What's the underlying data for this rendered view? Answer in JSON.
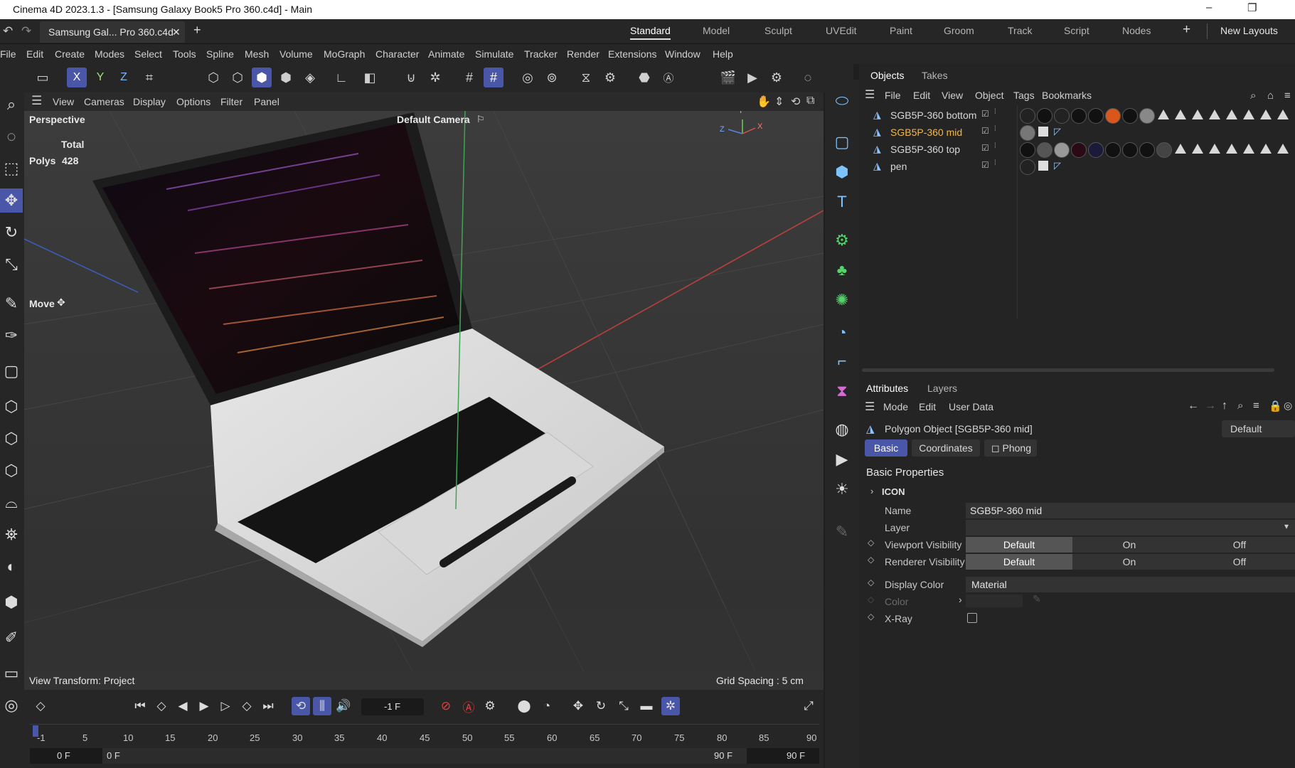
{
  "window": {
    "title": "Cinema 4D 2023.1.3 - [Samsung Galaxy Book5 Pro 360.c4d] - Main",
    "minimize": "–",
    "maximize": "❐",
    "close": "✕"
  },
  "tabs": {
    "doc_tab": "Samsung Gal... Pro 360.c4d",
    "doc_close": "✕",
    "add": "+",
    "layouts": [
      "Standard",
      "Model",
      "Sculpt",
      "UVEdit",
      "Paint",
      "Groom",
      "Track",
      "Script",
      "Nodes"
    ],
    "layouts_add": "+",
    "new_layouts": "New Layouts"
  },
  "menu": [
    "File",
    "Edit",
    "Create",
    "Modes",
    "Select",
    "Tools",
    "Spline",
    "Mesh",
    "Volume",
    "MoGraph",
    "Character",
    "Animate",
    "Simulate",
    "Tracker",
    "Render",
    "Extensions",
    "Window",
    "Help"
  ],
  "toolbar": {
    "axes": [
      "X",
      "Y",
      "Z"
    ]
  },
  "viewport": {
    "menu": [
      "View",
      "Cameras",
      "Display",
      "Options",
      "Filter",
      "Panel"
    ],
    "projection": "Perspective",
    "camera": "Default Camera",
    "camera_icon": "⚐",
    "stats_total_label": "Total",
    "stats_polys_label": "Polys",
    "stats_polys_value": "428",
    "tool_label": "Move",
    "view_transform": "View Transform: Project",
    "grid_spacing": "Grid Spacing : 5 cm",
    "axis_labels": [
      "Y",
      "Z",
      "X"
    ]
  },
  "objects_panel": {
    "tabs": [
      "Objects",
      "Takes"
    ],
    "menu": [
      "File",
      "Edit",
      "View",
      "Object",
      "Tags",
      "Bookmarks"
    ],
    "rows": [
      {
        "name": "SGB5P-360 bottom",
        "selected": false
      },
      {
        "name": "SGB5P-360 mid",
        "selected": true
      },
      {
        "name": "SGB5P-360 top",
        "selected": false
      },
      {
        "name": "pen",
        "selected": false
      }
    ]
  },
  "attributes_panel": {
    "tabs": [
      "Attributes",
      "Layers"
    ],
    "menu": [
      "Mode",
      "Edit",
      "User Data"
    ],
    "object_title": "Polygon Object [SGB5P-360 mid]",
    "preset": "Default",
    "subtabs": [
      "Basic",
      "Coordinates",
      "Phong"
    ],
    "phong_prefix": "◻",
    "section": "Basic Properties",
    "icon_group": "ICON",
    "fields": {
      "name_label": "Name",
      "name_value": "SGB5P-360 mid",
      "layer_label": "Layer",
      "viewport_visibility_label": "Viewport Visibility",
      "renderer_visibility_label": "Renderer Visibility",
      "visibility_options": [
        "Default",
        "On",
        "Off"
      ],
      "display_color_label": "Display Color",
      "display_color_value": "Material",
      "color_label": "Color",
      "xray_label": "X-Ray"
    }
  },
  "timeline": {
    "current_frame": "-1 F",
    "ticks": [
      "-1",
      "5",
      "10",
      "15",
      "20",
      "25",
      "30",
      "35",
      "40",
      "45",
      "50",
      "55",
      "60",
      "65",
      "70",
      "75",
      "80",
      "85",
      "90"
    ],
    "start_frame": "0 F",
    "range_start": "0 F",
    "range_end": "90 F",
    "end_frame": "90 F"
  },
  "colors": {
    "accent": "#4a57a8",
    "selected_object": "#f3b845",
    "icon_blue": "#7dc4ff",
    "icon_green": "#55d46a"
  }
}
